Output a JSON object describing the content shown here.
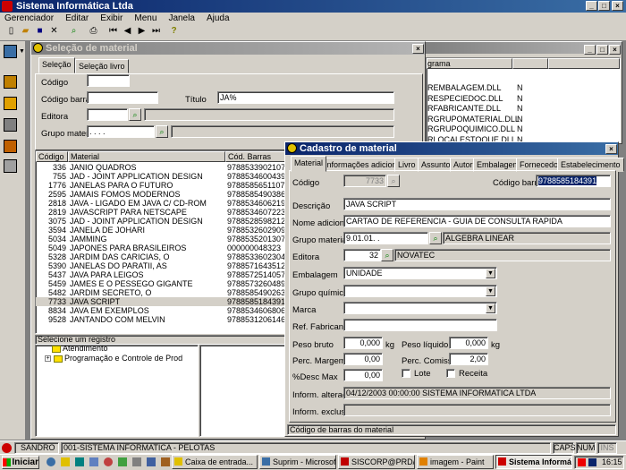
{
  "app": {
    "title": "Sistema Informática Ltda",
    "menu": [
      "Gerenciador",
      "Editar",
      "Exibir",
      "Menu",
      "Janela",
      "Ajuda"
    ]
  },
  "background_window": {
    "header": "grama",
    "rows": [
      {
        "name": "REMBALAGEM.DLL",
        "flag": "N"
      },
      {
        "name": "RESPECIEDOC.DLL",
        "flag": "N"
      },
      {
        "name": "RFABRICANTE.DLL",
        "flag": "N"
      },
      {
        "name": "RGRUPOMATERIAL.DLL",
        "flag": "N"
      },
      {
        "name": "RGRUPOQUIMICO.DLL",
        "flag": "N"
      },
      {
        "name": "RLOCALESTOQUE.DLL",
        "flag": "N"
      }
    ]
  },
  "selecao": {
    "title": "Seleção de material",
    "tabs": [
      "Seleção",
      "Seleção livro"
    ],
    "labels": {
      "codigo": "Código",
      "codigo_barras": "Código barras",
      "titulo": "Título",
      "editora": "Editora",
      "grupo_material": "Grupo material"
    },
    "titulo_value": "JA%",
    "grupo_mask": ". . . .",
    "columns": [
      "Código",
      "Material",
      "Cód. Barras"
    ],
    "rows": [
      {
        "codigo": "336",
        "material": "JANIO QUADROS",
        "barras": "9788533902107"
      },
      {
        "codigo": "755",
        "material": "JAD - JOINT APPLICATION DESIGN",
        "barras": "9788534600439"
      },
      {
        "codigo": "1776",
        "material": "JANELAS PARA O FUTURO",
        "barras": "9788585651107"
      },
      {
        "codigo": "2595",
        "material": "JAMAIS FOMOS MODERNOS",
        "barras": "9788585490386"
      },
      {
        "codigo": "2818",
        "material": "JAVA - LIGADO EM JAVA C/ CD-ROM",
        "barras": "9788534606219"
      },
      {
        "codigo": "2819",
        "material": "JAVASCRIPT PARA NETSCAPE",
        "barras": "9788534607223"
      },
      {
        "codigo": "3075",
        "material": "JAD - JOINT APPLICATION DESIGN",
        "barras": "9788528598212"
      },
      {
        "codigo": "3594",
        "material": "JANELA DE JOHARI",
        "barras": "9788532602909"
      },
      {
        "codigo": "5034",
        "material": "JAMMING",
        "barras": "9788535201307"
      },
      {
        "codigo": "5049",
        "material": "JAPONES PARA BRASILEIROS",
        "barras": "000000048323"
      },
      {
        "codigo": "5328",
        "material": "JARDIM DAS CARICIAS, O",
        "barras": "9788533602304"
      },
      {
        "codigo": "5390",
        "material": "JANELAS DO PARATII, AS",
        "barras": "9788571643512"
      },
      {
        "codigo": "5437",
        "material": "JAVA PARA LEIGOS",
        "barras": "9788572514057"
      },
      {
        "codigo": "5459",
        "material": "JAMES E O PESSEGO GIGANTE",
        "barras": "9788573260489"
      },
      {
        "codigo": "5482",
        "material": "JARDIM SECRETO, O",
        "barras": "9788585490263"
      },
      {
        "codigo": "7733",
        "material": "JAVA SCRIPT",
        "barras": "9788585184391"
      },
      {
        "codigo": "8834",
        "material": "JAVA EM EXEMPLOS",
        "barras": "9788534606806"
      },
      {
        "codigo": "9528",
        "material": "JANTANDO COM MELVIN",
        "barras": "9788531206146"
      }
    ],
    "status": "Selecione um registro"
  },
  "tree": {
    "items": [
      "Atendimento",
      "Programação e Controle de Prod"
    ]
  },
  "cadastro": {
    "title": "Cadastro de material",
    "tabs": [
      "Material",
      "Informações adicionais",
      "Livro",
      "Assunto",
      "Autor",
      "Embalagem",
      "Fornecedor",
      "Estabelecimento"
    ],
    "labels": {
      "codigo": "Código",
      "codigo_barras": "Código barras",
      "descricao": "Descrição",
      "nome_adicional": "Nome adicional",
      "grupo_material": "Grupo material",
      "editora": "Editora",
      "embalagem": "Embalagem",
      "grupo_quimico": "Grupo químico",
      "marca": "Marca",
      "ref_fabricante": "Ref. Fabricante",
      "peso_bruto": "Peso bruto",
      "peso_liquido": "Peso líquido",
      "perc_margem": "Perc. Margem",
      "perc_comissao": "Perc. Comissão",
      "desc_max": "%Desc Max",
      "lote": "Lote",
      "receita": "Receita",
      "inform_alteracao": "Inform. alteração",
      "inform_exclusao": "Inform. exclusão",
      "kg": "kg"
    },
    "values": {
      "codigo": "7733",
      "codigo_barras": "9788585184391",
      "descricao": "JAVA SCRIPT",
      "nome_adicional": "CARTAO DE REFERENCIA - GUIA DE CONSULTA RAPIDA",
      "grupo_material_code": "9.01.01. .",
      "grupo_material_name": "ALGEBRA LINEAR",
      "editora_code": "32",
      "editora_name": "NOVATEC",
      "embalagem": "UNIDADE",
      "peso_bruto": "0,000",
      "peso_liquido": "0,000",
      "perc_margem": "0,00",
      "perc_comissao": "2,00",
      "desc_max": "0,00",
      "inform_alteracao": "04/12/2003 00:00:00  SISTEMA INFORMATICA LTDA"
    },
    "status": "Código de barras do material"
  },
  "statusbar": {
    "user": "SANDRO",
    "company": "001-SISTEMA INFORMATICA - PELOTAS",
    "caps": "CAPS",
    "num": "NUM",
    "ins": "INS"
  },
  "taskbar": {
    "start": "Iniciar",
    "tasks": [
      "Caixa de entrada...",
      "Suprim - Microsof...",
      "SISCORP@PRD/",
      "imagem - Paint",
      "Sistema Informá..."
    ],
    "clock": "16:15"
  },
  "colors": {
    "titlebar": "#0a246a",
    "selection": "#0a246a",
    "face": "#d4d0c8"
  }
}
